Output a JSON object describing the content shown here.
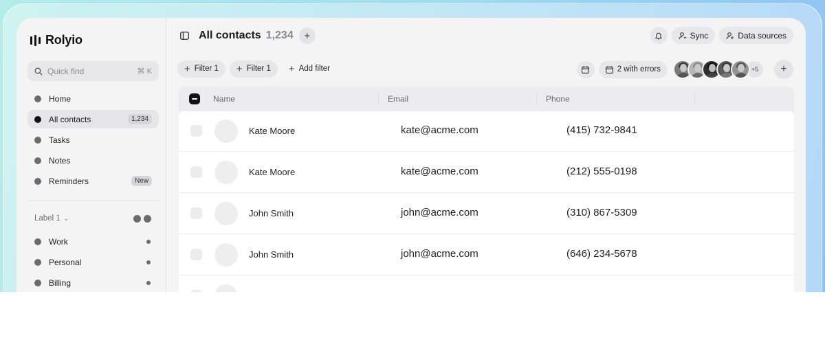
{
  "app": {
    "name": "Rolyio"
  },
  "sidebar": {
    "search": {
      "placeholder": "Quick find",
      "shortcut": "⌘ K"
    },
    "items": [
      {
        "label": "Home",
        "badge": ""
      },
      {
        "label": "All contacts",
        "badge": "1,234"
      },
      {
        "label": "Tasks",
        "badge": ""
      },
      {
        "label": "Notes",
        "badge": ""
      },
      {
        "label": "Reminders",
        "badge": "New"
      }
    ],
    "label_group": {
      "title": "Label 1"
    },
    "labels": [
      {
        "label": "Work"
      },
      {
        "label": "Personal"
      },
      {
        "label": "Billing"
      }
    ]
  },
  "header": {
    "title": "All contacts",
    "count": "1,234",
    "sync_label": "Sync",
    "data_sources_label": "Data sources"
  },
  "filters": {
    "chips": [
      "Filter 1",
      "Filter 1"
    ],
    "add_filter_label": "Add filter",
    "errors_label": "2 with errors",
    "more_avatars": "+5"
  },
  "table": {
    "columns": [
      "Name",
      "Email",
      "Phone"
    ],
    "rows": [
      {
        "name": "Kate Moore",
        "email": "kate@acme.com",
        "phone": "(415) 732-9841"
      },
      {
        "name": "Kate Moore",
        "email": "kate@acme.com",
        "phone": "(212) 555-0198"
      },
      {
        "name": "John Smith",
        "email": "john@acme.com",
        "phone": "(310) 867-5309"
      },
      {
        "name": "John Smith",
        "email": "john@acme.com",
        "phone": "(646) 234-5678"
      }
    ]
  },
  "colors": {
    "accent": "#111111",
    "background_gradient_start": "#b3ece9",
    "background_gradient_end": "#8fc3f5"
  }
}
